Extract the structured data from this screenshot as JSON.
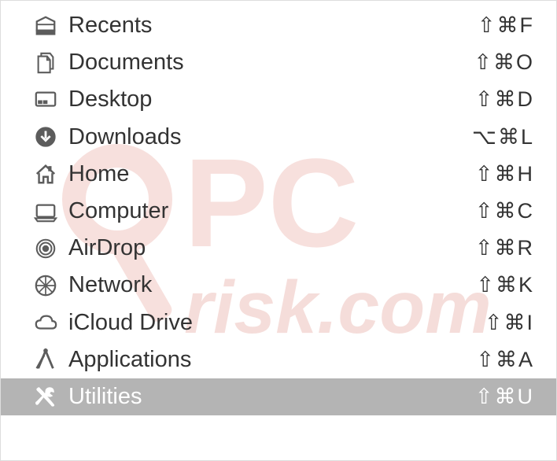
{
  "menu": {
    "items": [
      {
        "id": "recents",
        "label": "Recents",
        "shortcut": "⇧⌘F",
        "selected": false
      },
      {
        "id": "documents",
        "label": "Documents",
        "shortcut": "⇧⌘O",
        "selected": false
      },
      {
        "id": "desktop",
        "label": "Desktop",
        "shortcut": "⇧⌘D",
        "selected": false
      },
      {
        "id": "downloads",
        "label": "Downloads",
        "shortcut": "⌥⌘L",
        "selected": false
      },
      {
        "id": "home",
        "label": "Home",
        "shortcut": "⇧⌘H",
        "selected": false
      },
      {
        "id": "computer",
        "label": "Computer",
        "shortcut": "⇧⌘C",
        "selected": false
      },
      {
        "id": "airdrop",
        "label": "AirDrop",
        "shortcut": "⇧⌘R",
        "selected": false
      },
      {
        "id": "network",
        "label": "Network",
        "shortcut": "⇧⌘K",
        "selected": false
      },
      {
        "id": "icloud-drive",
        "label": "iCloud Drive",
        "shortcut": "⇧⌘I",
        "selected": false
      },
      {
        "id": "applications",
        "label": "Applications",
        "shortcut": "⇧⌘A",
        "selected": false
      },
      {
        "id": "utilities",
        "label": "Utilities",
        "shortcut": "⇧⌘U",
        "selected": true
      }
    ]
  },
  "watermark": "PCrisk.com"
}
